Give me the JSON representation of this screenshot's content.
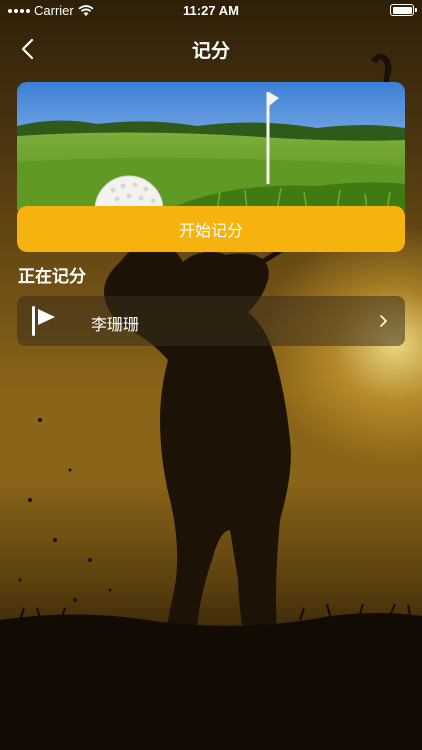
{
  "status_bar": {
    "carrier": "Carrier",
    "time": "11:27 AM"
  },
  "nav": {
    "title": "记分"
  },
  "banner": {
    "start_button_label": "开始记分"
  },
  "in_progress": {
    "section_title": "正在记分",
    "items": [
      {
        "name": "李珊珊"
      }
    ]
  },
  "colors": {
    "accent": "#F6B20D",
    "text": "#FFFFFF"
  },
  "icons": {
    "back": "chevron-left-icon",
    "flag": "flag-icon",
    "row_arrow": "chevron-right-icon",
    "wifi": "wifi-icon",
    "battery": "battery-icon"
  }
}
